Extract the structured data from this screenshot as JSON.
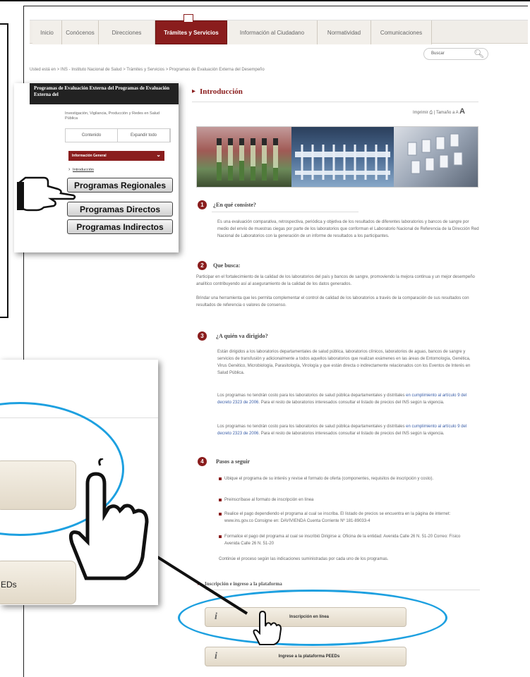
{
  "nav": {
    "tabs": [
      "Inicio",
      "Conócenos",
      "Direcciones",
      "Trámites y Servicios",
      "Información al Ciudadano",
      "Normatividad",
      "Comunicaciones"
    ],
    "active_index": 3
  },
  "search": {
    "placeholder": "Buscar"
  },
  "breadcrumb": "Usted está en > INS - Instituto Nacional de Salud > Trámites y Servicios > Programas de Evaluación Externa del Desempeño",
  "intro_title": "Introducción",
  "tools": {
    "print": "Imprimir",
    "size": "Tamaño",
    "a_small": "a",
    "a_mid": "A",
    "a_big": "A"
  },
  "sections": {
    "s1": {
      "num": "1",
      "title": "¿En qué consiste?",
      "text": "Es una evaluación comparativa, retrospectiva, periódica y objetiva de los resultados de diferentes laboratorios y bancos de sangre por medio del envío de muestras ciegas por parte de los laboratorios que conforman el Laboratorio Nacional de Referencia de la Dirección Red Nacional de Laboratorios con la generación de un informe de resultados a los participantes."
    },
    "s2": {
      "num": "2",
      "title": "Que busca:",
      "text1": "Participar en el fortalecimiento de la calidad de los laboratorios del país y bancos de sangre, promoviendo la mejora continua y un mejor desempeño analítico contribuyendo así al aseguramiento de la calidad de los datos generados.",
      "text2": "Brindar una herramienta que les permita complementar el control de calidad de los laboratorios a través de la comparación de sus resultados con resultados de referencia o valores de consenso."
    },
    "s3": {
      "num": "3",
      "title": "¿A quién va dirigido?",
      "text1": "Están dirigidos a los laboratorios departamentales de salud pública, laboratorios clínicos, laboratorios de aguas, bancos de sangre y servicios de transfusión y adicionalmente a todos aquellos laboratorios que realizan exámenes en las áreas de Entomología, Genética, Virus Genético, Microbiología, Parasitología, Virología y que están directa o indirectamente relacionados con los Eventos de Interés en Salud Pública.",
      "text2a": "Los programas no tendrán costo para los laboratorios de salud pública departamentales y distritales ",
      "link": "en cumplimiento al artículo 9 del decreto 2323 de 2006",
      "text2b": ". Para el resto de laboratorios interesados consultar el listado de precios del INS según la vigencia."
    },
    "s4": {
      "num": "4",
      "title": "Pasos a seguir",
      "items": [
        "Ubique el programa de su interés y revise el formato de oferta (componentes, requisitos de inscripción y costo).",
        "Preinscríbase al formato de inscripción en línea",
        "Realice el pago dependiendo el programa al cual se inscriba. El listado de precios se encuentra en la página de internet: www.ins.gov.co Consigne en: DAVIVIENDA Cuenta Corriente Nº 181-89033-4",
        "Formalice el pago del programa al cual se inscribió Dirigirse a: Oficina de la entidad: Avenida Calle 26 N. 51-20 Correo: Físico Avenida Calle 26 N. 51-20"
      ],
      "closing": "Continúe el proceso según las indicaciones suministradas por cada uno de los programas."
    }
  },
  "insc_title": "Inscripción e ingreso a la plataforma",
  "buttons": {
    "inscripcion": "Inscripción en línea",
    "ingreso": "Ingrese a la plataforma PEEDs",
    "icon": "i"
  },
  "inset1": {
    "header": "Programas de Evaluación Externa del Programas de Evaluación Externa del",
    "subtitle": "Investigación, Vigilancia, Producción y Redes en Salud Pública",
    "tab_contenido": "Contenido",
    "tab_expandir": "Expandir todo",
    "info_general": "Información General",
    "intro_link": "Introducción",
    "buttons": [
      "Programas Regionales",
      "Programas Directos",
      "Programas Indirectos"
    ]
  },
  "inset2": {
    "button_text": "EDs"
  },
  "colors": {
    "brand": "#8a1d1d",
    "highlight": "#1da0e0"
  }
}
